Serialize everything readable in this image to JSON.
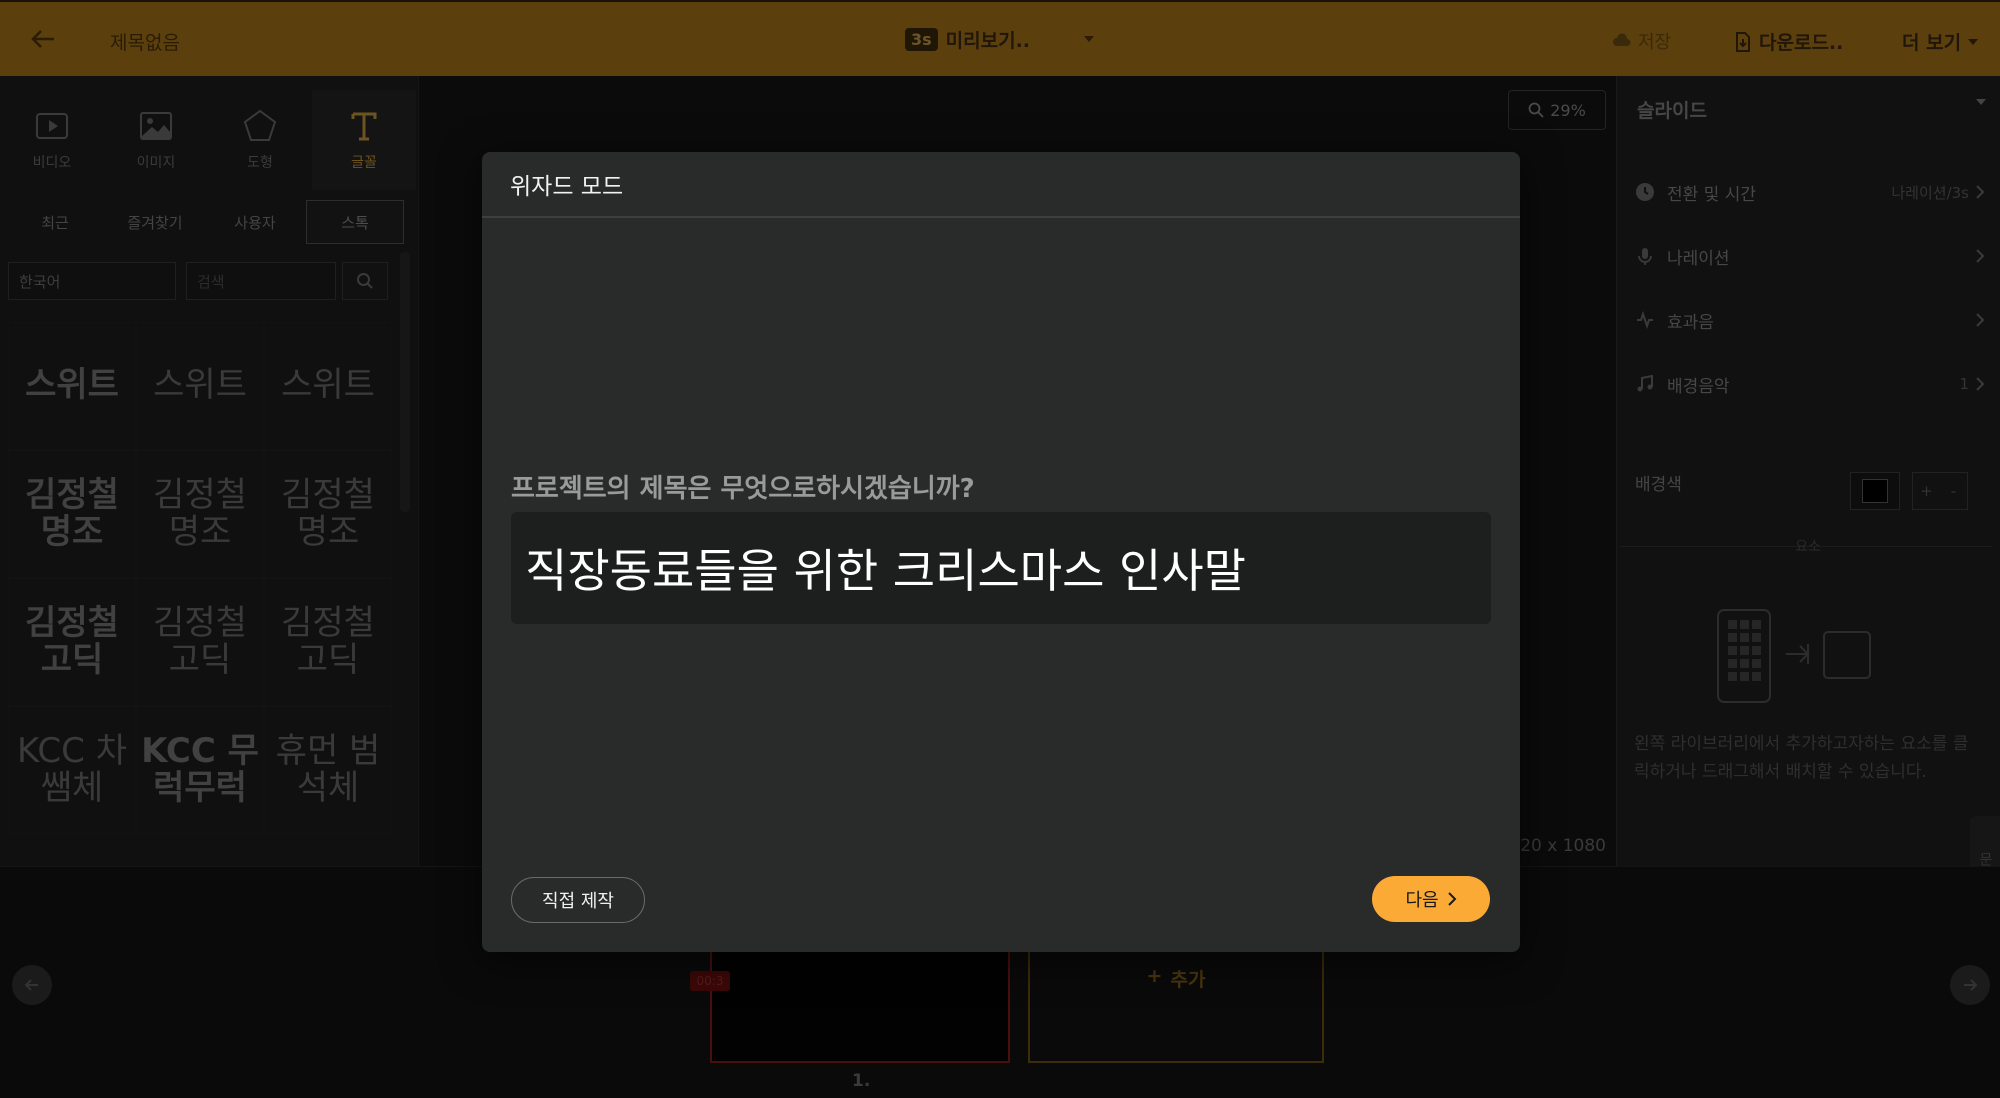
{
  "topbar": {
    "title": "제목없음",
    "preview_badge": "3s",
    "preview_label": "미리보기..",
    "save_label": "저장",
    "download_label": "다운로드..",
    "more_label": "더 보기"
  },
  "library": {
    "tabs": [
      {
        "label": "비디오",
        "icon": "video-icon"
      },
      {
        "label": "이미지",
        "icon": "image-icon"
      },
      {
        "label": "도형",
        "icon": "pentagon-icon"
      },
      {
        "label": "글꼴",
        "icon": "text-icon",
        "active": true
      }
    ],
    "subtabs": [
      "최근",
      "즐겨찾기",
      "사용자",
      "스톡"
    ],
    "active_subtab": "스톡",
    "language": "한국어",
    "search_placeholder": "검색",
    "fonts": [
      "스위트",
      "스위트",
      "스위트",
      "김정철 명조",
      "김정철 명조",
      "김정철 명조",
      "김정철 고딕",
      "김정철 고딕",
      "김정철 고딕",
      "KCC 차쌤체",
      "KCC 무럭무럭",
      "휴먼 범석체"
    ]
  },
  "canvas": {
    "zoom": "29%",
    "size": "1920 x 1080"
  },
  "right_panel": {
    "section": "슬라이드",
    "rows": [
      {
        "label": "전환 및 시간",
        "value": "나레이션/3s",
        "icon": "clock-icon"
      },
      {
        "label": "나레이션",
        "value": "",
        "icon": "mic-icon"
      },
      {
        "label": "효과음",
        "value": "",
        "icon": "sound-effect-icon"
      },
      {
        "label": "배경음악",
        "value": "1",
        "icon": "music-note-icon"
      }
    ],
    "background_label": "배경색",
    "background_color": "#000000",
    "plus": "+",
    "minus": "-",
    "elements_label": "요소",
    "help_text": "왼쪽 라이브러리에서 추가하고자하는 요소를 클릭하거나 드래그해서 배치할 수 있습니다.",
    "side_tab": "문의"
  },
  "timeline": {
    "slide_tag": "00:3",
    "slide_number": "1.",
    "add_label": "추가"
  },
  "modal": {
    "title": "위자드 모드",
    "question": "프로젝트의 제목은 무엇으로하시겠습니까?",
    "input_value": "직장동료들을 위한 크리스마스 인사말",
    "direct_label": "직접 제작",
    "next_label": "다음",
    "accent_color": "#fbab35"
  }
}
